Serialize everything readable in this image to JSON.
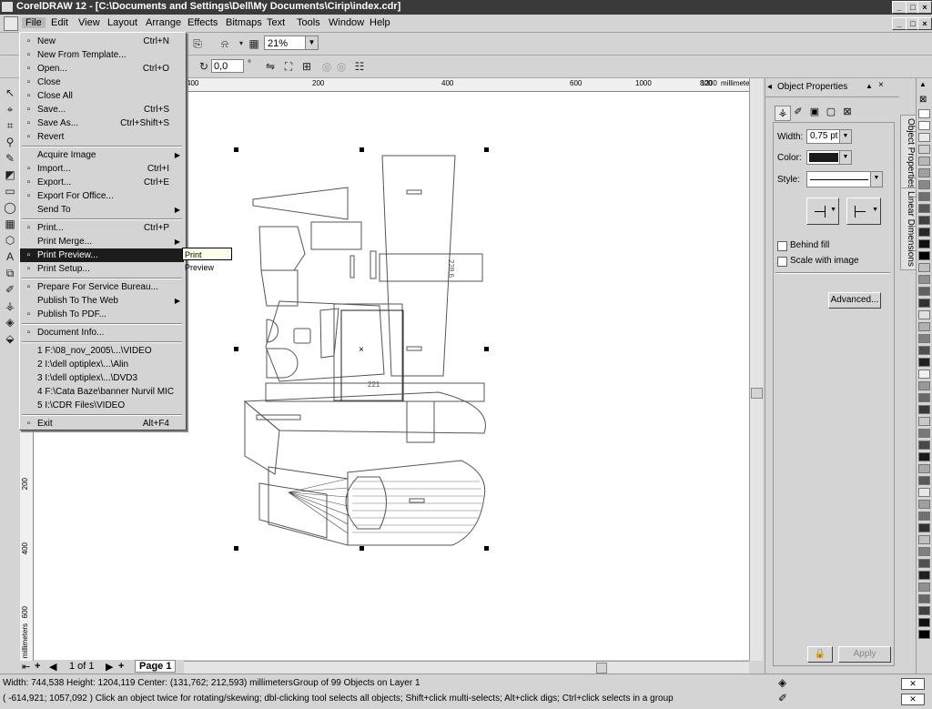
{
  "window": {
    "title": "CorelDRAW 12 - [C:\\Documents and Settings\\Dell\\My Documents\\Cirip\\index.cdr]",
    "min": "_",
    "max": "□",
    "close": "×"
  },
  "menubar": [
    "File",
    "Edit",
    "View",
    "Layout",
    "Arrange",
    "Effects",
    "Bitmaps",
    "Text",
    "Tools",
    "Window",
    "Help"
  ],
  "toolbar": {
    "zoom": "21%",
    "angle": "0,0",
    "angle_unit": "°"
  },
  "rulers": {
    "h_ticks": [
      "400",
      "200",
      "400",
      "600",
      "800",
      "1000",
      "1200"
    ],
    "h_unit": "millimeters",
    "v_ticks": [
      "200",
      "400",
      "600"
    ],
    "v_unit": "millimeters"
  },
  "file_menu": {
    "items": [
      {
        "label": "New",
        "shortcut": "Ctrl+N",
        "icon": "new-doc-icon"
      },
      {
        "label": "New From Template...",
        "shortcut": "",
        "icon": "template-icon"
      },
      {
        "label": "Open...",
        "shortcut": "Ctrl+O",
        "icon": "open-folder-icon"
      },
      {
        "label": "Close",
        "shortcut": "",
        "icon": "close-doc-icon"
      },
      {
        "label": "Close All",
        "shortcut": "",
        "icon": "close-all-icon"
      },
      {
        "label": "Save...",
        "shortcut": "Ctrl+S",
        "icon": "save-icon"
      },
      {
        "label": "Save As...",
        "shortcut": "Ctrl+Shift+S",
        "icon": "save-as-icon"
      },
      {
        "label": "Revert",
        "shortcut": "",
        "icon": "revert-icon"
      },
      {
        "label": "Acquire Image",
        "shortcut": "",
        "icon": "",
        "submenu": true
      },
      {
        "label": "Import...",
        "shortcut": "Ctrl+I",
        "icon": "import-icon"
      },
      {
        "label": "Export...",
        "shortcut": "Ctrl+E",
        "icon": "export-icon"
      },
      {
        "label": "Export For Office...",
        "shortcut": "",
        "icon": "export-office-icon"
      },
      {
        "label": "Send To",
        "shortcut": "",
        "icon": "",
        "submenu": true
      },
      {
        "label": "Print...",
        "shortcut": "Ctrl+P",
        "icon": "print-icon"
      },
      {
        "label": "Print Merge...",
        "shortcut": "",
        "icon": "",
        "submenu": true
      },
      {
        "label": "Print Preview...",
        "shortcut": "",
        "icon": "print-preview-icon",
        "highlight": true
      },
      {
        "label": "Print Setup...",
        "shortcut": "",
        "icon": "print-setup-icon"
      },
      {
        "label": "Prepare For Service Bureau...",
        "shortcut": "",
        "icon": "service-bureau-icon"
      },
      {
        "label": "Publish To The Web",
        "shortcut": "",
        "icon": "",
        "submenu": true
      },
      {
        "label": "Publish To PDF...",
        "shortcut": "",
        "icon": "pdf-icon"
      },
      {
        "label": "Document Info...",
        "shortcut": "",
        "icon": "info-icon"
      },
      {
        "label": "1 F:\\08_nov_2005\\...\\VIDEO",
        "shortcut": "",
        "icon": ""
      },
      {
        "label": "2 I:\\dell optiplex\\...\\Alin",
        "shortcut": "",
        "icon": ""
      },
      {
        "label": "3 I:\\dell optiplex\\...\\DVD3",
        "shortcut": "",
        "icon": ""
      },
      {
        "label": "4 F:\\Cata Baze\\banner Nurvil MIC",
        "shortcut": "",
        "icon": ""
      },
      {
        "label": "5 I:\\CDR Files\\VIDEO",
        "shortcut": "",
        "icon": ""
      },
      {
        "label": "Exit",
        "shortcut": "Alt+F4",
        "icon": "exit-icon"
      }
    ],
    "tooltip": "Print Preview"
  },
  "canvas": {
    "dim_label_1": "228,6",
    "dim_label_2": "221"
  },
  "pages": {
    "counter": "1 of 1",
    "tab": "Page 1"
  },
  "panel": {
    "title": "Object Properties",
    "width_label": "Width:",
    "width_value": "0,75 pt",
    "color_label": "Color:",
    "color_value": "#1a1a1a",
    "style_label": "Style:",
    "behind_fill": "Behind fill",
    "scale_with_image": "Scale with image",
    "advanced": "Advanced...",
    "apply": "Apply"
  },
  "side_tabs": [
    "Object Properties",
    "Linear Dimensions"
  ],
  "palette": [
    "#ffffff",
    "#ffffff",
    "#e8e8e8",
    "#d0d0d0",
    "#b8b8b8",
    "#a0a0a0",
    "#888888",
    "#707070",
    "#585858",
    "#404040",
    "#282828",
    "#101010",
    "#000000",
    "#c0c0c0",
    "#909090",
    "#606060",
    "#303030",
    "#e0e0e0",
    "#b0b0b0",
    "#808080",
    "#505050",
    "#202020",
    "#f0f0f0",
    "#989898",
    "#686868",
    "#383838",
    "#c8c8c8",
    "#787878",
    "#484848",
    "#181818",
    "#a8a8a8",
    "#585858",
    "#e8e8e8",
    "#a0a0a0",
    "#707070",
    "#303030",
    "#c0c0c0",
    "#808080",
    "#505050",
    "#202020",
    "#909090",
    "#686868",
    "#404040",
    "#101010",
    "#000000"
  ],
  "status": {
    "line1": "Width: 744,538  Height: 1204,119  Center: (131,762; 212,593)  millimeters",
    "line1b": "Group of 99 Objects on Layer 1",
    "line2": "( -614,921; 1057,092 )  Click an object twice for rotating/skewing; dbl-clicking tool selects all objects; Shift+click multi-selects; Alt+click digs; Ctrl+click selects in a group"
  }
}
